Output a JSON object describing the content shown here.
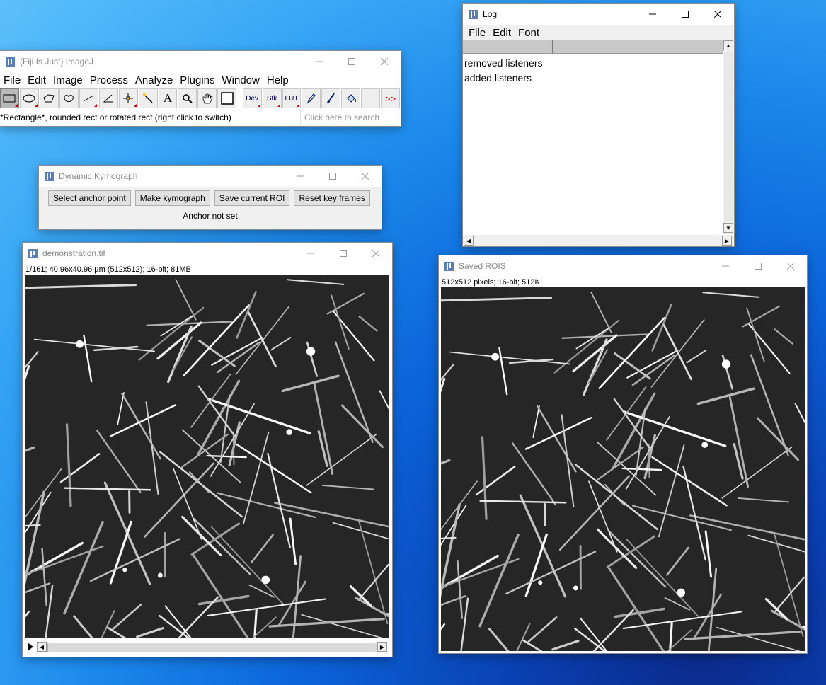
{
  "imagej": {
    "title": "(Fiji Is Just) ImageJ",
    "menus": [
      "File",
      "Edit",
      "Image",
      "Process",
      "Analyze",
      "Plugins",
      "Window",
      "Help"
    ],
    "status": "*Rectangle*, rounded rect or rotated rect (right click to switch)",
    "search_placeholder": "Click here to search",
    "tools": {
      "dev": "Dev",
      "stk": "Stk",
      "lut": "LUT",
      "text": "A",
      "more": ">>"
    }
  },
  "kymograph": {
    "title": "Dynamic Kymograph",
    "buttons": {
      "anchor": "Select anchor point",
      "make": "Make kymograph",
      "save": "Save current ROI",
      "reset": "Reset key frames"
    },
    "status": "Anchor not set"
  },
  "log": {
    "title": "Log",
    "menus": [
      "File",
      "Edit",
      "Font"
    ],
    "lines": [
      "removed listeners",
      "added listeners"
    ]
  },
  "demo": {
    "title": "demonstration.tif",
    "info": "1/161; 40.96x40.96 µm (512x512); 16-bit; 81MB"
  },
  "saved": {
    "title": "Saved ROIS",
    "info": "512x512 pixels; 16-bit; 512K"
  },
  "colors": {
    "tool_triangle": "#c00000",
    "desktop_blue": "#0b63d8"
  }
}
